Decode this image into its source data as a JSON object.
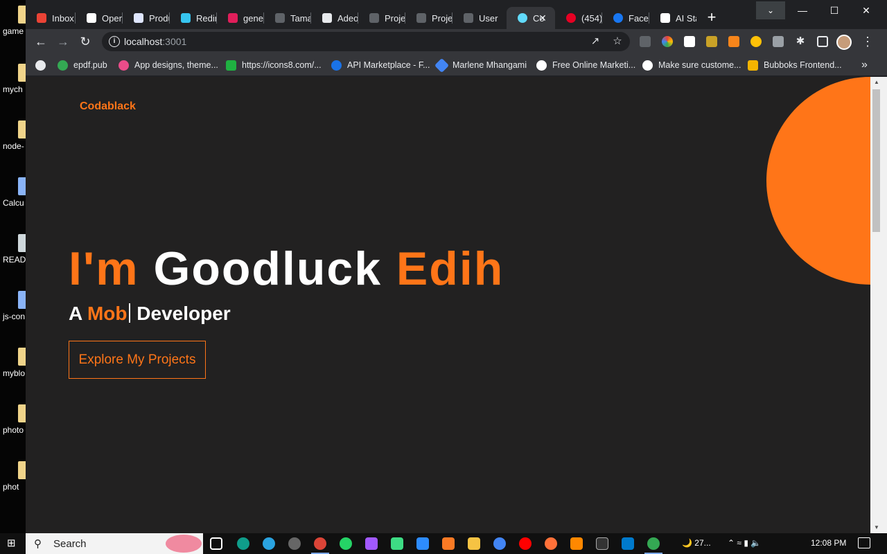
{
  "desktop": {
    "items": [
      {
        "label": "game"
      },
      {
        "label": "mych"
      },
      {
        "label": "node-"
      },
      {
        "label": "Calcu"
      },
      {
        "label": "READM"
      },
      {
        "label": "js-con"
      },
      {
        "label": "myblo"
      },
      {
        "label": "photo"
      },
      {
        "label": "phot"
      }
    ]
  },
  "browser": {
    "tabs": [
      {
        "label": "Inbox",
        "color": "#ea4335"
      },
      {
        "label": "Open",
        "color": "#ffffff"
      },
      {
        "label": "Produ",
        "color": "#dfe6ff"
      },
      {
        "label": "Redir",
        "color": "#36c5f0"
      },
      {
        "label": "gener",
        "color": "#e01e5a"
      },
      {
        "label": "Tamal",
        "color": "#9aa0a6"
      },
      {
        "label": "Adeo",
        "color": "#e8eaed"
      },
      {
        "label": "Proje",
        "color": "#5f6368"
      },
      {
        "label": "Proje",
        "color": "#5f6368"
      },
      {
        "label": "User",
        "color": "#5f6368"
      },
      {
        "label": "Co",
        "color": "#61dafb"
      },
      {
        "label": "(454)",
        "color": "#e60023"
      },
      {
        "label": "Faceb",
        "color": "#1877f2"
      },
      {
        "label": "AI Sta",
        "color": "#ffffff"
      }
    ],
    "tab_close": "✕",
    "new_tab": "+",
    "address": {
      "host": "localhost",
      "port": ":3001"
    },
    "bookmarks": [
      {
        "label": "",
        "color": "#e8eaed"
      },
      {
        "label": "epdf.pub",
        "color": "#34a853"
      },
      {
        "label": "App designs, theme...",
        "color": "#ea4c89"
      },
      {
        "label": "https://icons8.com/...",
        "color": "#1fb141"
      },
      {
        "label": "API Marketplace - F...",
        "color": "#1a73e8"
      },
      {
        "label": "Marlene Mhangami",
        "color": "#4285f4"
      },
      {
        "label": "Free Online Marketi...",
        "color": "#ffffff"
      },
      {
        "label": "Make sure custome...",
        "color": "#ffffff"
      },
      {
        "label": "Bubboks Frontend...",
        "color": "#f4b400"
      }
    ],
    "bookmarks_more": "»"
  },
  "page": {
    "logo": "Codablack",
    "hero": {
      "part1": "I'm",
      "part2": "Goodluck",
      "part3": "Edih"
    },
    "subtitle": {
      "prefix": "A",
      "typed": "Mob",
      "suffix": "Developer"
    },
    "cta_label": "Explore My Projects",
    "accent_color": "#ff7518",
    "background_color": "#222121"
  },
  "taskbar": {
    "search_label": "Search",
    "weather": "27...",
    "clock": "12:08 PM"
  }
}
